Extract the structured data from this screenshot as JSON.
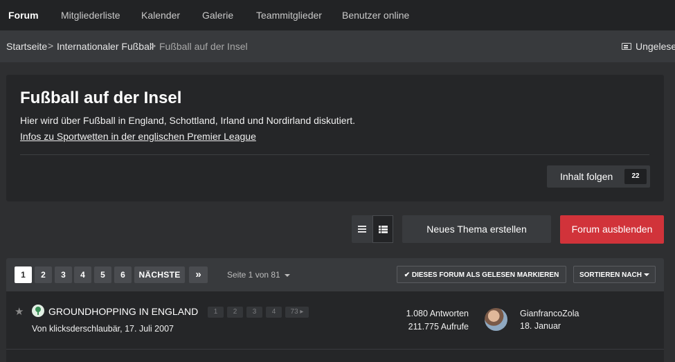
{
  "nav": {
    "items": [
      {
        "label": "Forum",
        "active": true
      },
      {
        "label": "Mitgliederliste"
      },
      {
        "label": "Kalender"
      },
      {
        "label": "Galerie"
      },
      {
        "label": "Teammitglieder"
      },
      {
        "label": "Benutzer online"
      }
    ]
  },
  "breadcrumb": {
    "items": [
      "Startseite",
      "Internationaler Fußball",
      "Fußball auf der Insel"
    ],
    "separator": ">",
    "unread_label": "Ungelese",
    "unread_icon": "newspaper-icon"
  },
  "forum": {
    "title": "Fußball auf der Insel",
    "description": "Hier wird über Fußball in England, Schottland, Irland und Nordirland diskutiert.",
    "link": "Infos zu Sportwetten in der englischen Premier League",
    "follow_label": "Inhalt folgen",
    "follow_count": "22"
  },
  "actions": {
    "view_list_icon": "list-view-icon",
    "view_grid_icon": "grid-view-icon",
    "new_topic": "Neues Thema erstellen",
    "hide_forum": "Forum ausblenden"
  },
  "pagination": {
    "pages": [
      "1",
      "2",
      "3",
      "4",
      "5",
      "6"
    ],
    "current": "1",
    "next": "NÄCHSTE",
    "last": "»",
    "page_info": "Seite 1 von 81",
    "mark_read": "✔ DIESES FORUM ALS GELESEN MARKIEREN",
    "sort": "SORTIEREN NACH"
  },
  "topics": [
    {
      "title": "GROUNDHOPPING IN ENGLAND",
      "pages": [
        "1",
        "2",
        "3",
        "4",
        "73 ▸"
      ],
      "byline": "Von klicksderschlaubär, 17. Juli 2007",
      "replies": "1.080 Antworten",
      "views": "211.775 Aufrufe",
      "last_user": "GianfrancoZola",
      "last_date": "18. Januar",
      "pinned": true
    }
  ],
  "colors": {
    "accent_red": "#d1333a",
    "background": "#2e2f31",
    "card": "#252628",
    "nav": "#222325"
  }
}
